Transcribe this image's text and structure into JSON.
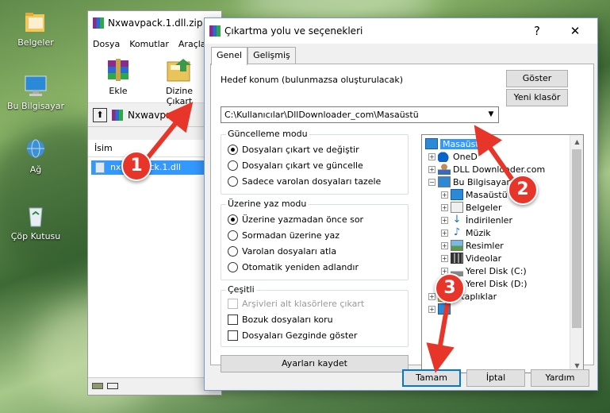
{
  "desktop": {
    "icons": [
      {
        "label": "Belgeler",
        "icon": "folder-icon"
      },
      {
        "label": "Bu Bilgisayar",
        "icon": "computer-icon"
      },
      {
        "label": "Ağ",
        "icon": "network-icon"
      },
      {
        "label": "Çöp Kutusu",
        "icon": "recycle-bin-icon"
      }
    ]
  },
  "winrar": {
    "title": "Nxwavpack.1.dll.zip",
    "menu": [
      "Dosya",
      "Komutlar",
      "Araçla"
    ],
    "tools": [
      {
        "label": "Ekle",
        "icon": "add-archive-icon"
      },
      {
        "label": "Dizine Çıkart",
        "icon": "extract-to-icon"
      }
    ],
    "path": "Nxwavpack",
    "column_header": "İsim",
    "file": "nxwavpack.1.dll"
  },
  "dialog": {
    "title": "Çıkartma yolu ve seçenekleri",
    "help": "?",
    "close": "✕",
    "tabs": [
      "Genel",
      "Gelişmiş"
    ],
    "target_label": "Hedef konum (bulunmazsa oluşturulacak)",
    "target_value": "C:\\Kullanıcılar\\DllDownloader_com\\Masaüstü",
    "show_button": "Göster",
    "new_folder_button": "Yeni klasör",
    "update_group": {
      "title": "Güncelleme modu",
      "options": [
        "Dosyaları çıkart ve değiştir",
        "Dosyaları çıkart ve güncelle",
        "Sadece varolan dosyaları tazele"
      ],
      "selected": 0
    },
    "overwrite_group": {
      "title": "Üzerine yaz modu",
      "options": [
        "Üzerine yazmadan önce sor",
        "Sormadan üzerine yaz",
        "Varolan dosyaları atla",
        "Otomatik yeniden adlandır"
      ],
      "selected": 0
    },
    "misc_group": {
      "title": "Çeşitli",
      "options": [
        "Arşivleri alt klasörlere çıkart",
        "Bozuk dosyaları koru",
        "Dosyaları Gezginde göster"
      ]
    },
    "save_settings_button": "Ayarları kaydet",
    "tree": [
      {
        "label": "Masaüstü",
        "icon": "desktop-icon",
        "selected": true
      },
      {
        "label": "OneD",
        "icon": "onedrive-icon"
      },
      {
        "label": "DLL Downloader.com",
        "icon": "user-icon"
      },
      {
        "label": "Bu Bilgisayar",
        "icon": "computer-icon"
      },
      {
        "label": "Masaüstü",
        "icon": "desktop-icon"
      },
      {
        "label": "Belgeler",
        "icon": "documents-icon"
      },
      {
        "label": "İndirilenler",
        "icon": "downloads-icon"
      },
      {
        "label": "Müzik",
        "icon": "music-icon"
      },
      {
        "label": "Resimler",
        "icon": "pictures-icon"
      },
      {
        "label": "Videolar",
        "icon": "videos-icon"
      },
      {
        "label": "Yerel Disk (C:)",
        "icon": "disk-icon"
      },
      {
        "label": "Yerel Disk (D:)",
        "icon": "disk-icon"
      },
      {
        "label": "Kitaplıklar",
        "icon": "libraries-icon"
      }
    ],
    "ok_button": "Tamam",
    "cancel_button": "İptal",
    "help_button": "Yardım"
  },
  "annotations": [
    "1",
    "2",
    "3"
  ],
  "colors": {
    "badge": "#e8352a",
    "selection": "#3399ff",
    "accent": "#0078d7"
  }
}
